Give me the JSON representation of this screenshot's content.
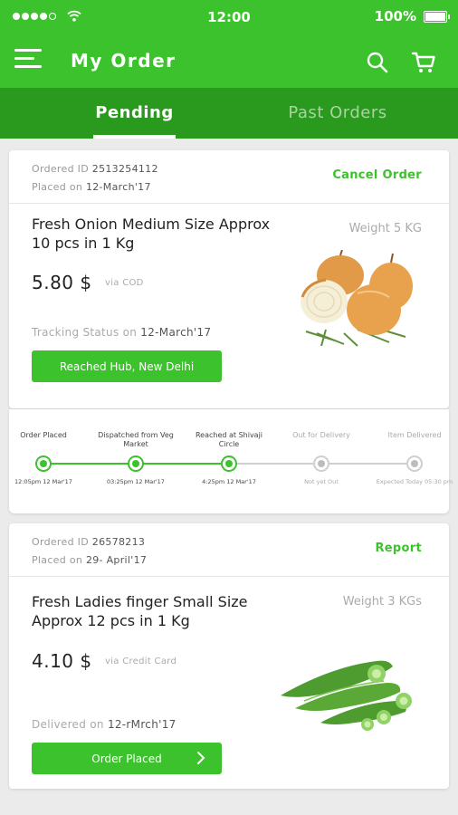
{
  "status_bar": {
    "time": "12:00",
    "battery": "100%"
  },
  "header": {
    "title": "My Order"
  },
  "tabs": [
    {
      "label": "Pending"
    },
    {
      "label": "Past Orders"
    }
  ],
  "orders": [
    {
      "id_label": "Ordered ID",
      "id": "2513254112",
      "placed_label": "Placed on",
      "placed_date": "12-March'17",
      "action": "Cancel Order",
      "product": "Fresh Onion  Medium Size Approx 10 pcs in 1 Kg",
      "weight": "Weight 5 KG",
      "price": "5.80 $",
      "payment": "via COD",
      "status_label": "Tracking Status on",
      "status_date": "12-March'17",
      "button": "Reached Hub, New Delhi"
    },
    {
      "id_label": "Ordered ID",
      "id": "26578213",
      "placed_label": "Placed on",
      "placed_date": "29- April'17",
      "action": "Report",
      "product": "Fresh Ladies finger Small Size Approx 12 pcs in 1 Kg",
      "weight": "Weight 3 KGs",
      "price": "4.10 $",
      "payment": "via Credit Card",
      "status_label": "Delivered on",
      "status_date": "12-rMrch'17",
      "button": "Order Placed"
    }
  ],
  "timeline": [
    {
      "label": "Order Placed",
      "time": "12:05pm 12 Mar'17",
      "done": true
    },
    {
      "label": "Dispatched from Veg Market",
      "time": "03:25pm 12 Mar'17",
      "done": true
    },
    {
      "label": "Reached at Shivaji Circle",
      "time": "4:25pm 12 Mar'17",
      "done": true
    },
    {
      "label": "Out for Delivery",
      "time": "Not yet Out",
      "done": false
    },
    {
      "label": "Item Delivered",
      "time": "Expected Today 05:30 pm",
      "done": false
    }
  ],
  "colors": {
    "brand": "#3cc22c",
    "tab_bar": "#2a9a1f"
  },
  "icons": [
    "menu-icon",
    "search-icon",
    "cart-icon",
    "wifi-icon",
    "battery-icon",
    "chevron-right-icon"
  ]
}
